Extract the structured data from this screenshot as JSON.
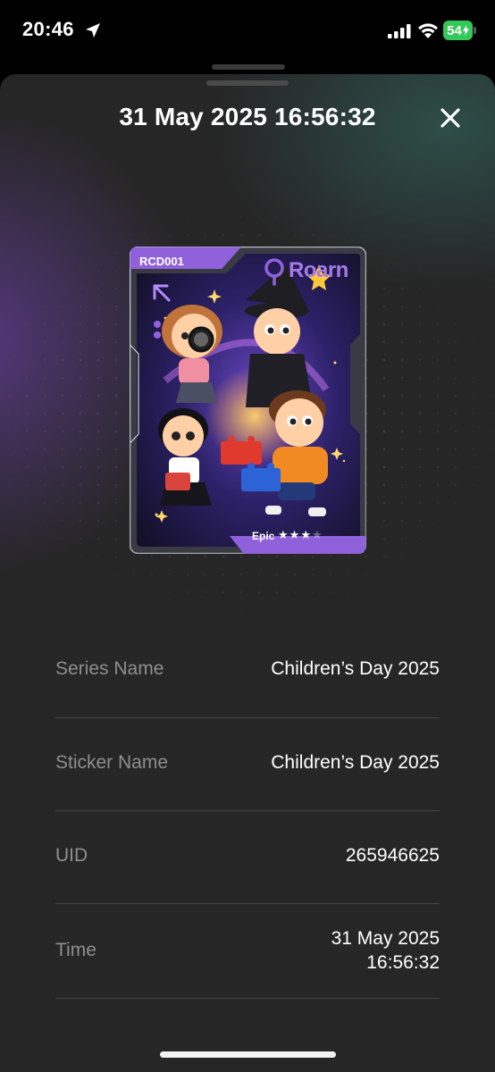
{
  "status_bar": {
    "time": "20:46",
    "battery": "54",
    "icons": [
      "location-arrow-icon",
      "cellular-signal-icon",
      "wifi-icon",
      "battery-charging-icon"
    ]
  },
  "sheet": {
    "title": "31 May 2025 16:56:32",
    "close_icon": "close-icon"
  },
  "sticker": {
    "code": "RCD001",
    "brand": "Roarn",
    "rarity": "Epic",
    "rating": 3,
    "rating_max": 4
  },
  "details": {
    "series_name_label": "Series Name",
    "series_name_value": "Children’s Day 2025",
    "sticker_name_label": "Sticker Name",
    "sticker_name_value": "Children’s Day 2025",
    "uid_label": "UID",
    "uid_value": "265946625",
    "time_label": "Time",
    "time_value_line1": "31 May 2025",
    "time_value_line2": "16:56:32"
  },
  "colors": {
    "sheet_bg": "#262626",
    "accent_purple": "#8f62dc",
    "battery_green": "#34c759",
    "label_gray": "#8e8e8e"
  }
}
